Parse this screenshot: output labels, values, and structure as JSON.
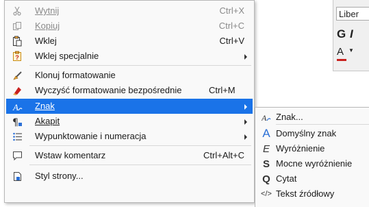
{
  "background_app": {
    "font_name": "Liber",
    "bold_glyph": "G",
    "italic_glyph": "I",
    "font_color_glyph": "A"
  },
  "menu": {
    "items": [
      {
        "label": "Wytnij",
        "shortcut": "Ctrl+X",
        "icon": "scissors-icon",
        "disabled": true
      },
      {
        "label": "Kopiuj",
        "shortcut": "Ctrl+C",
        "icon": "copy-icon",
        "disabled": true
      },
      {
        "label": "Wklej",
        "shortcut": "Ctrl+V",
        "icon": "paste-icon"
      },
      {
        "label": "Wklej specjalnie",
        "shortcut": "",
        "icon": "paste-special-icon",
        "submenu": true
      },
      {
        "label": "Klonuj formatowanie",
        "shortcut": "",
        "icon": "clone-brush-icon"
      },
      {
        "label": "Wyczyść formatowanie bezpośrednie",
        "shortcut": "Ctrl+M",
        "icon": "clear-formatting-icon"
      },
      {
        "label": "Znak",
        "shortcut": "",
        "icon": "character-icon",
        "submenu": true,
        "highlighted": true
      },
      {
        "label": "Akapit",
        "shortcut": "",
        "icon": "paragraph-icon",
        "submenu": true
      },
      {
        "label": "Wypunktowanie i numeracja",
        "shortcut": "",
        "icon": "bullets-numbering-icon",
        "submenu": true
      },
      {
        "label": "Wstaw komentarz",
        "shortcut": "Ctrl+Alt+C",
        "icon": "comment-icon"
      },
      {
        "label": "Styl strony...",
        "shortcut": "",
        "icon": "page-style-icon"
      }
    ]
  },
  "submenu": {
    "items": [
      {
        "label": "Znak...",
        "icon": "character-dialog-icon",
        "glyph": ""
      },
      {
        "label": "Domyślny znak",
        "icon": "default-character-icon",
        "glyph": "A"
      },
      {
        "label": "Wyróżnienie",
        "icon": "emphasis-icon",
        "glyph": "E"
      },
      {
        "label": "Mocne wyróżnienie",
        "icon": "strong-emphasis-icon",
        "glyph": "S"
      },
      {
        "label": "Cytat",
        "icon": "quote-icon",
        "glyph": "Q"
      },
      {
        "label": "Tekst źródłowy",
        "icon": "source-text-icon",
        "glyph": "</>"
      }
    ]
  },
  "colors": {
    "highlight": "#1a73e8",
    "menu_bg": "#f9f9f9",
    "disabled_text": "#8a8a8a",
    "accent_red": "#c9211e",
    "accent_blue": "#2a6fd6"
  }
}
